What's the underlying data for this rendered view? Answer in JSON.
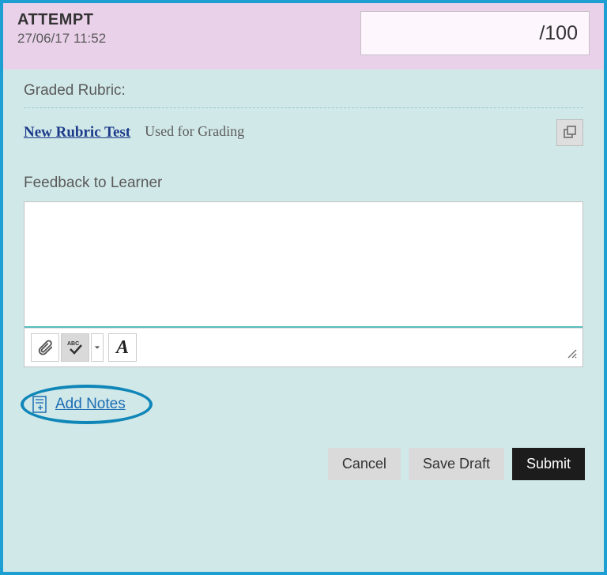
{
  "header": {
    "title": "ATTEMPT",
    "date": "27/06/17 11:52",
    "grade_max": "/100",
    "grade_value": ""
  },
  "rubric": {
    "section_label": "Graded Rubric:",
    "link_text": "New Rubric Test",
    "status": "Used for Grading"
  },
  "feedback": {
    "label": "Feedback to Learner",
    "value": ""
  },
  "toolbar": {
    "attachment_icon": "attachment-icon",
    "spellcheck_icon": "spellcheck-icon",
    "dropdown_icon": "chevron-down-icon",
    "font_icon": "font-format-icon"
  },
  "notes": {
    "add_label": "Add Notes"
  },
  "buttons": {
    "cancel": "Cancel",
    "save_draft": "Save Draft",
    "submit": "Submit"
  }
}
